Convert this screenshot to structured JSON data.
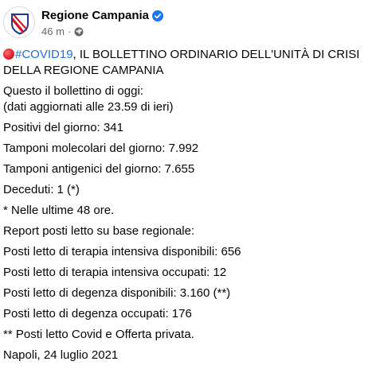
{
  "page": {
    "name": "Regione Campania",
    "time": "46 m",
    "separator": "·"
  },
  "post": {
    "hashtag": "#COVID19",
    "headline_rest": ", IL BOLLETTINO ORDINARIO DELL'UNITÀ DI CRISI DELLA REGIONE CAMPANIA",
    "intro_line1": "Questo il bollettino di oggi:",
    "intro_line2": "(dati aggiornati alle 23.59 di ieri)",
    "lines": [
      "Positivi del giorno: 341",
      "Tamponi molecolari del giorno: 7.992",
      "Tamponi antigenici del giorno: 7.655",
      "Deceduti: 1 (*)",
      "* Nelle ultime 48 ore.",
      "Report posti letto su base regionale:",
      "Posti letto di terapia intensiva disponibili: 656",
      "Posti letto di terapia intensiva occupati: 12",
      "Posti letto di degenza disponibili: 3.160 (**)",
      "Posti letto di degenza occupati: 176",
      "** Posti letto Covid e Offerta privata.",
      "Napoli, 24 luglio 2021"
    ]
  },
  "colors": {
    "hashtag": "#216fdb",
    "verified": "#1877f2",
    "meta": "#65676b",
    "text": "#050505"
  },
  "icons": {
    "avatar": "regione-campania-crest",
    "verified": "verified-badge-icon",
    "audience": "globe-icon",
    "emoji": "red-circle-emoji"
  }
}
